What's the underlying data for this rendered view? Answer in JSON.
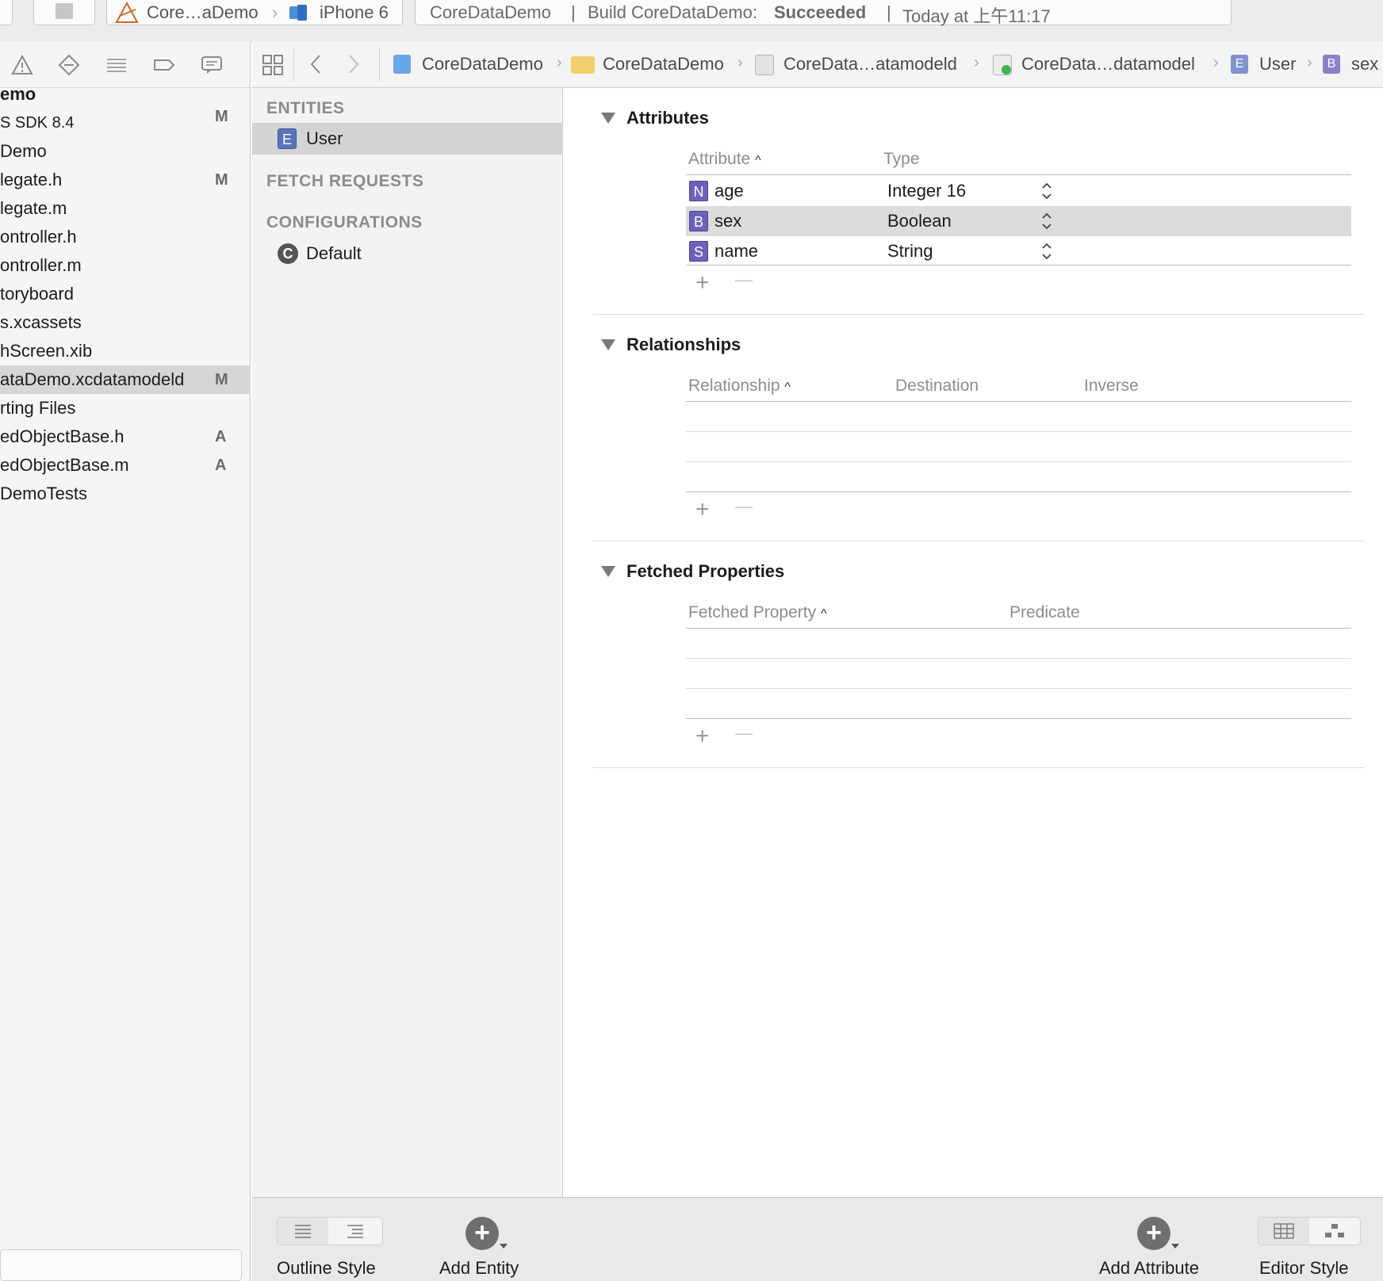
{
  "toolbar": {
    "scheme": "Core…aDemo",
    "device": "iPhone 6",
    "activity_project": "CoreDataDemo",
    "activity_sep1": "|",
    "activity_build": "Build CoreDataDemo:",
    "activity_status": "Succeeded",
    "activity_sep2": "|",
    "activity_time": "Today at 上午11:17"
  },
  "navigator": {
    "files": [
      {
        "name": "emo",
        "badge": ""
      },
      {
        "name": "S SDK 8.4",
        "badge": "M"
      },
      {
        "name": "Demo",
        "badge": ""
      },
      {
        "name": "legate.h",
        "badge": "M"
      },
      {
        "name": "legate.m",
        "badge": ""
      },
      {
        "name": "ontroller.h",
        "badge": ""
      },
      {
        "name": "ontroller.m",
        "badge": ""
      },
      {
        "name": "toryboard",
        "badge": ""
      },
      {
        "name": "s.xcassets",
        "badge": ""
      },
      {
        "name": "hScreen.xib",
        "badge": ""
      },
      {
        "name": "ataDemo.xcdatamodeld",
        "badge": "M"
      },
      {
        "name": "rting Files",
        "badge": ""
      },
      {
        "name": "edObjectBase.h",
        "badge": "A"
      },
      {
        "name": "edObjectBase.m",
        "badge": "A"
      },
      {
        "name": "DemoTests",
        "badge": ""
      }
    ]
  },
  "jumpbar": {
    "crumbs": [
      "CoreDataDemo",
      "CoreDataDemo",
      "CoreData…atamodeld",
      "CoreData…datamodel",
      "User",
      "sex"
    ],
    "badge_e": "E",
    "badge_b": "B"
  },
  "entities_panel": {
    "entities_header": "ENTITIES",
    "entities": [
      {
        "badge": "E",
        "name": "User"
      }
    ],
    "fetch_requests_header": "FETCH REQUESTS",
    "configurations_header": "CONFIGURATIONS",
    "configurations": [
      {
        "badge": "C",
        "name": "Default"
      }
    ]
  },
  "attributes": {
    "title": "Attributes",
    "col_attribute": "Attribute",
    "col_type": "Type",
    "rows": [
      {
        "badge": "N",
        "name": "age",
        "type": "Integer 16"
      },
      {
        "badge": "B",
        "name": "sex",
        "type": "Boolean"
      },
      {
        "badge": "S",
        "name": "name",
        "type": "String"
      }
    ]
  },
  "relationships": {
    "title": "Relationships",
    "col_relationship": "Relationship",
    "col_destination": "Destination",
    "col_inverse": "Inverse"
  },
  "fetched_properties": {
    "title": "Fetched Properties",
    "col_fetched_property": "Fetched Property",
    "col_predicate": "Predicate"
  },
  "bottombar": {
    "outline_style": "Outline Style",
    "add_entity": "Add Entity",
    "add_attribute": "Add Attribute",
    "editor_style": "Editor Style"
  },
  "glyphs": {
    "plus": "+",
    "minus": "—",
    "sort_up": "^",
    "stepper": "⌃⌄"
  },
  "colors": {
    "entity_badge": "#5b73b8",
    "attribute_badge": "#6b62b8",
    "selection": "#dcdcdc"
  }
}
